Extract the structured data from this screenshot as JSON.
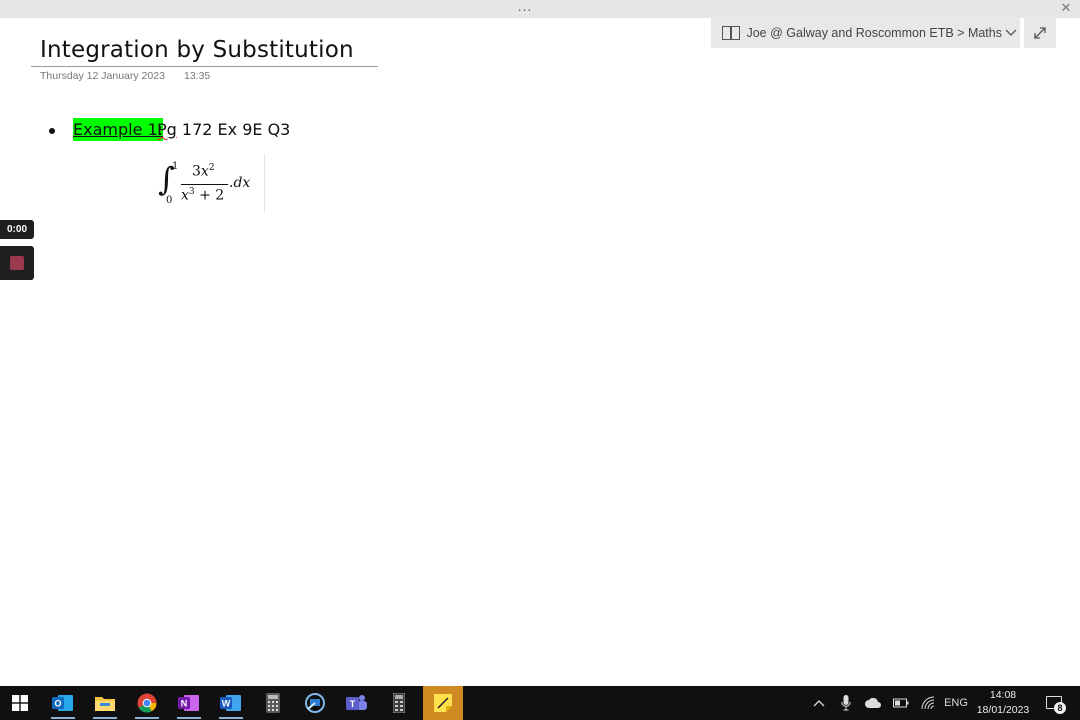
{
  "window": {
    "grip_label": "...",
    "close_label": "✕"
  },
  "notebook": {
    "breadcrumb": "Joe @ Galway and Roscommon ETB > Maths"
  },
  "page": {
    "title": "Integration by Substitution",
    "date": "Thursday 12 January 2023",
    "time": "13:35"
  },
  "content": {
    "example_label": "Example 1:",
    "reference_prefix": "Pg",
    "reference_rest": " 172 Ex 9E Q3",
    "math": {
      "integral_sign": "∫",
      "upper_limit": "1",
      "lower_limit": "0",
      "numerator_coef": "3",
      "numerator_var": "x",
      "numerator_exp": "2",
      "denominator_var": "x",
      "denominator_exp": "3",
      "denominator_rest": " + 2",
      "dx_dot": ".",
      "dx": "dx"
    }
  },
  "recorder": {
    "timer": "0:00"
  },
  "taskbar": {
    "apps": [
      {
        "name": "start",
        "icon": "windows-icon"
      },
      {
        "name": "outlook",
        "icon": "outlook-icon",
        "color": "#0f6cbd",
        "letter": "O"
      },
      {
        "name": "file-explorer",
        "icon": "folder-icon",
        "color": "#f6c443"
      },
      {
        "name": "chrome",
        "icon": "chrome-icon"
      },
      {
        "name": "onenote",
        "icon": "onenote-icon",
        "color": "#7719aa",
        "letter": "N"
      },
      {
        "name": "word",
        "icon": "word-icon",
        "color": "#185abd",
        "letter": "W"
      },
      {
        "name": "calculator",
        "icon": "calculator-icon"
      },
      {
        "name": "remote-desktop",
        "icon": "remote-desktop-icon"
      },
      {
        "name": "teams",
        "icon": "teams-icon",
        "color": "#5b5fc7",
        "letter": "T"
      },
      {
        "name": "calculator-2",
        "icon": "calculator-icon"
      },
      {
        "name": "sticky-notes",
        "icon": "sticky-notes-icon"
      }
    ],
    "tray": {
      "language": "ENG",
      "time": "14:08",
      "date": "18/01/2023",
      "notification_count": "8"
    }
  }
}
